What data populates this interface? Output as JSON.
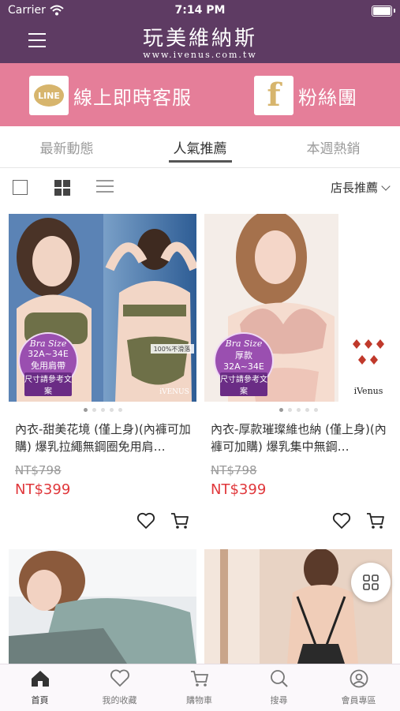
{
  "status": {
    "carrier": "Carrier",
    "time": "7:14 PM"
  },
  "header": {
    "logo_name": "玩美維納斯",
    "logo_url": "www.ivenus.com.tw"
  },
  "banner": {
    "line_icon_text": "LINE",
    "line_label": "線上即時客服",
    "fb_icon_text": "f",
    "fb_label": "粉絲團"
  },
  "tabs": [
    {
      "label": "最新動態"
    },
    {
      "label": "人氣推薦",
      "active": true
    },
    {
      "label": "本週熱銷"
    }
  ],
  "toolbar": {
    "sort_label": "店長推薦"
  },
  "products": [
    {
      "title": "內衣-甜美花境 (僅上身)(內褲可加購) 爆乳拉繩無鋼圈免用肩…",
      "original_price": "NT$798",
      "price": "NT$399",
      "badge": {
        "script": "Bra Size",
        "size": "32A~34E",
        "note": "免用肩帶",
        "sub": "尺寸請參考文案"
      },
      "overlay_text": "100%不滑落",
      "brand": "iVENUS"
    },
    {
      "title": "內衣-厚款璀璨維也納 (僅上身)(內褲可加購) 爆乳集中無鋼…",
      "original_price": "NT$798",
      "price": "NT$399",
      "badge": {
        "script": "Bra Size",
        "size": "厚款",
        "note": "32A~34E",
        "sub": "尺寸請參考文案"
      },
      "brand": "iVenus"
    }
  ],
  "bottom_nav": [
    {
      "label": "首頁",
      "icon": "home-icon",
      "active": true
    },
    {
      "label": "我的收藏",
      "icon": "heart-icon"
    },
    {
      "label": "購物車",
      "icon": "cart-icon"
    },
    {
      "label": "搜尋",
      "icon": "search-icon"
    },
    {
      "label": "會員專區",
      "icon": "user-icon"
    }
  ],
  "colors": {
    "header": "#5e3b63",
    "banner": "#e57e99",
    "price": "#e0373b",
    "gold": "#d7b56d"
  }
}
